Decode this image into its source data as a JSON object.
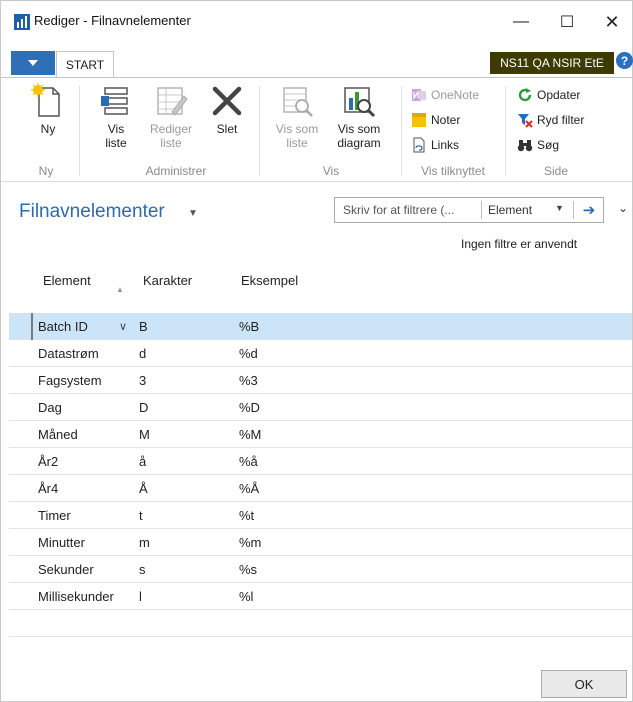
{
  "window": {
    "title": "Rediger - Filnavnelementer",
    "min_glyph": "—",
    "max_glyph": "☐",
    "close_glyph": "✕"
  },
  "tabstrip": {
    "start_tab": "START",
    "company_badge": "NS11 QA NSIR EtE",
    "help_glyph": "?"
  },
  "ribbon": {
    "new": {
      "label": "Ny",
      "group": "Ny"
    },
    "admin": {
      "group": "Administrer",
      "view_list_1": "Vis",
      "view_list_2": "liste",
      "edit_list_1": "Rediger",
      "edit_list_2": "liste",
      "delete": "Slet"
    },
    "view": {
      "group": "Vis",
      "as_list_1": "Vis som",
      "as_list_2": "liste",
      "as_diagram_1": "Vis som",
      "as_diagram_2": "diagram"
    },
    "related": {
      "group": "Vis tilknyttet",
      "onenote": "OneNote",
      "notes": "Noter",
      "links": "Links"
    },
    "page": {
      "group": "Side",
      "refresh": "Opdater",
      "clear_filter": "Ryd filter",
      "search": "Søg"
    }
  },
  "page": {
    "title": "Filnavnelementer",
    "filter_placeholder": "Skriv for at filtrere (...",
    "filter_field": "Element",
    "filters_status": "Ingen filtre er anvendt"
  },
  "table": {
    "headers": [
      "Element",
      "Karakter",
      "Eksempel"
    ],
    "rows": [
      [
        "Batch ID",
        "B",
        "%B"
      ],
      [
        "Datastrøm",
        "d",
        "%d"
      ],
      [
        "Fagsystem",
        "3",
        "%3"
      ],
      [
        "Dag",
        "D",
        "%D"
      ],
      [
        "Måned",
        "M",
        "%M"
      ],
      [
        "År2",
        "å",
        "%å"
      ],
      [
        "År4",
        "Å",
        "%Å"
      ],
      [
        "Timer",
        "t",
        "%t"
      ],
      [
        "Minutter",
        "m",
        "%m"
      ],
      [
        "Sekunder",
        "s",
        "%s"
      ],
      [
        "Millisekunder",
        "l",
        "%l"
      ]
    ]
  },
  "footer": {
    "ok": "OK"
  },
  "colors": {
    "accent_blue": "#2c6ab1",
    "selected_row": "#cce4f7",
    "badge_bg": "#3e3b00"
  }
}
